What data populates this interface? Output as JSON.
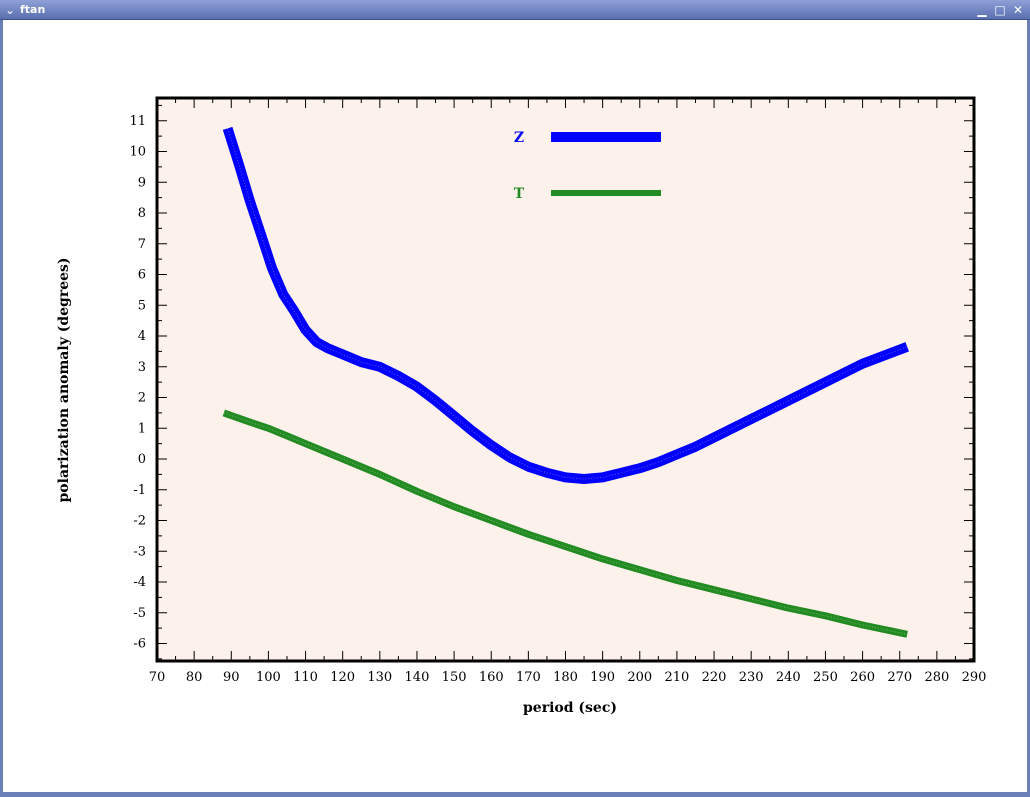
{
  "window": {
    "title": "ftan",
    "menu_icon": "chevron-down-icon",
    "minimize_icon": "minimize-icon",
    "maximize_icon": "maximize-icon",
    "close_icon": "close-icon"
  },
  "colors": {
    "plot_background": "#fdf1ec",
    "titlebar": "#6b7fb8",
    "series_z": "#0000ff",
    "series_t": "#228b22"
  },
  "chart_data": {
    "type": "line",
    "title": "",
    "xlabel": "period (sec)",
    "ylabel": "polarization anomaly (degrees)",
    "xlim": [
      70,
      290
    ],
    "ylim": [
      -6.6,
      12.0
    ],
    "xticks": [
      70,
      80,
      90,
      100,
      110,
      120,
      130,
      140,
      150,
      160,
      170,
      180,
      190,
      200,
      210,
      220,
      230,
      240,
      250,
      260,
      270,
      280,
      290
    ],
    "yticks": [
      -6,
      -5,
      -4,
      -3,
      -2,
      -1,
      0,
      1,
      2,
      3,
      4,
      5,
      6,
      7,
      8,
      9,
      10,
      11
    ],
    "grid": false,
    "legend_position": "top-center",
    "series": [
      {
        "name": "Z",
        "color": "#0000ff",
        "x": [
          89,
          92,
          95,
          98,
          101,
          104,
          107,
          110,
          113,
          116,
          120,
          125,
          130,
          135,
          140,
          145,
          150,
          155,
          160,
          165,
          170,
          175,
          180,
          185,
          190,
          195,
          200,
          205,
          210,
          215,
          220,
          230,
          240,
          250,
          260,
          272
        ],
        "y": [
          10.75,
          9.6,
          8.4,
          7.3,
          6.2,
          5.35,
          4.8,
          4.2,
          3.8,
          3.6,
          3.4,
          3.15,
          3.0,
          2.7,
          2.35,
          1.9,
          1.4,
          0.9,
          0.45,
          0.05,
          -0.25,
          -0.45,
          -0.6,
          -0.65,
          -0.6,
          -0.45,
          -0.3,
          -0.1,
          0.15,
          0.4,
          0.7,
          1.3,
          1.9,
          2.5,
          3.1,
          3.65
        ]
      },
      {
        "name": "T",
        "color": "#228b22",
        "x": [
          88,
          95,
          100,
          105,
          110,
          120,
          130,
          140,
          150,
          160,
          170,
          180,
          190,
          200,
          210,
          220,
          230,
          240,
          250,
          260,
          272
        ],
        "y": [
          1.5,
          1.2,
          1.0,
          0.75,
          0.5,
          0.0,
          -0.5,
          -1.05,
          -1.55,
          -2.0,
          -2.45,
          -2.85,
          -3.25,
          -3.6,
          -3.95,
          -4.25,
          -4.55,
          -4.85,
          -5.1,
          -5.4,
          -5.7
        ]
      }
    ]
  }
}
